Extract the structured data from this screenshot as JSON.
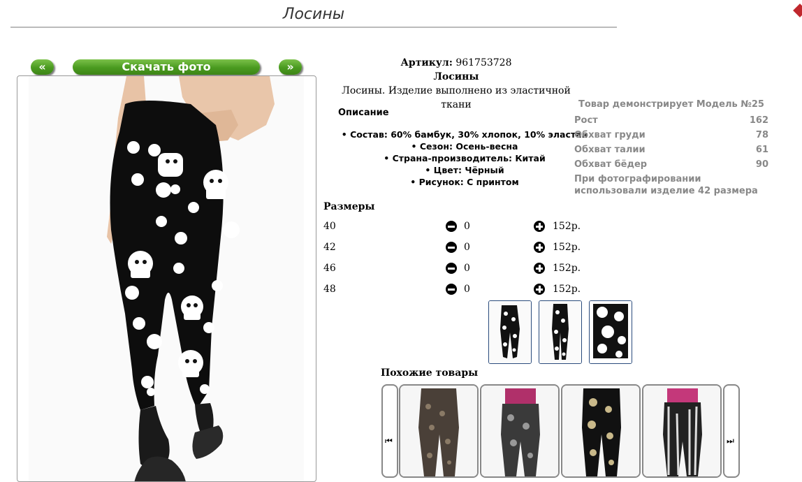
{
  "page": {
    "title": "Лосины"
  },
  "gallery": {
    "prev_label": "«",
    "download_label": "Скачать фото",
    "next_label": "»"
  },
  "product": {
    "article_label": "Артикул:",
    "article_value": "961753728",
    "name": "Лосины",
    "summary": "Лосины. Изделие выполнено из эластичной ткани"
  },
  "description": {
    "title": "Описание",
    "items": [
      "Состав: 60% бамбук, 30% хлопок, 10% эластан",
      "Сезон: Осень-весна",
      "Страна-производитель: Китай",
      "Цвет: Чёрный",
      "Рисунок: С принтом"
    ]
  },
  "model": {
    "title": "Товар демонстрирует Модель №25",
    "rows": [
      {
        "label": "Рост",
        "value": "162"
      },
      {
        "label": "Обхват груди",
        "value": "78"
      },
      {
        "label": "Обхват талии",
        "value": "61"
      },
      {
        "label": "Обхват бёдер",
        "value": "90"
      }
    ],
    "note": "При фотографировании использовали изделие 42 размера"
  },
  "sizes": {
    "title": "Размеры",
    "rows": [
      {
        "size": "40",
        "qty": "0",
        "price": "152р."
      },
      {
        "size": "42",
        "qty": "0",
        "price": "152р."
      },
      {
        "size": "46",
        "qty": "0",
        "price": "152р."
      },
      {
        "size": "48",
        "qty": "0",
        "price": "152р."
      }
    ]
  },
  "similar": {
    "title": "Похожие товары"
  },
  "icons": {
    "minus": "minus-circle-icon",
    "plus": "plus-circle-icon",
    "carousel_prev": "skip-previous-icon",
    "carousel_next": "skip-next-icon"
  },
  "colors": {
    "button_green": "#4a9a1f",
    "thumb_border": "#2a4b7c",
    "muted_text": "#888888"
  }
}
